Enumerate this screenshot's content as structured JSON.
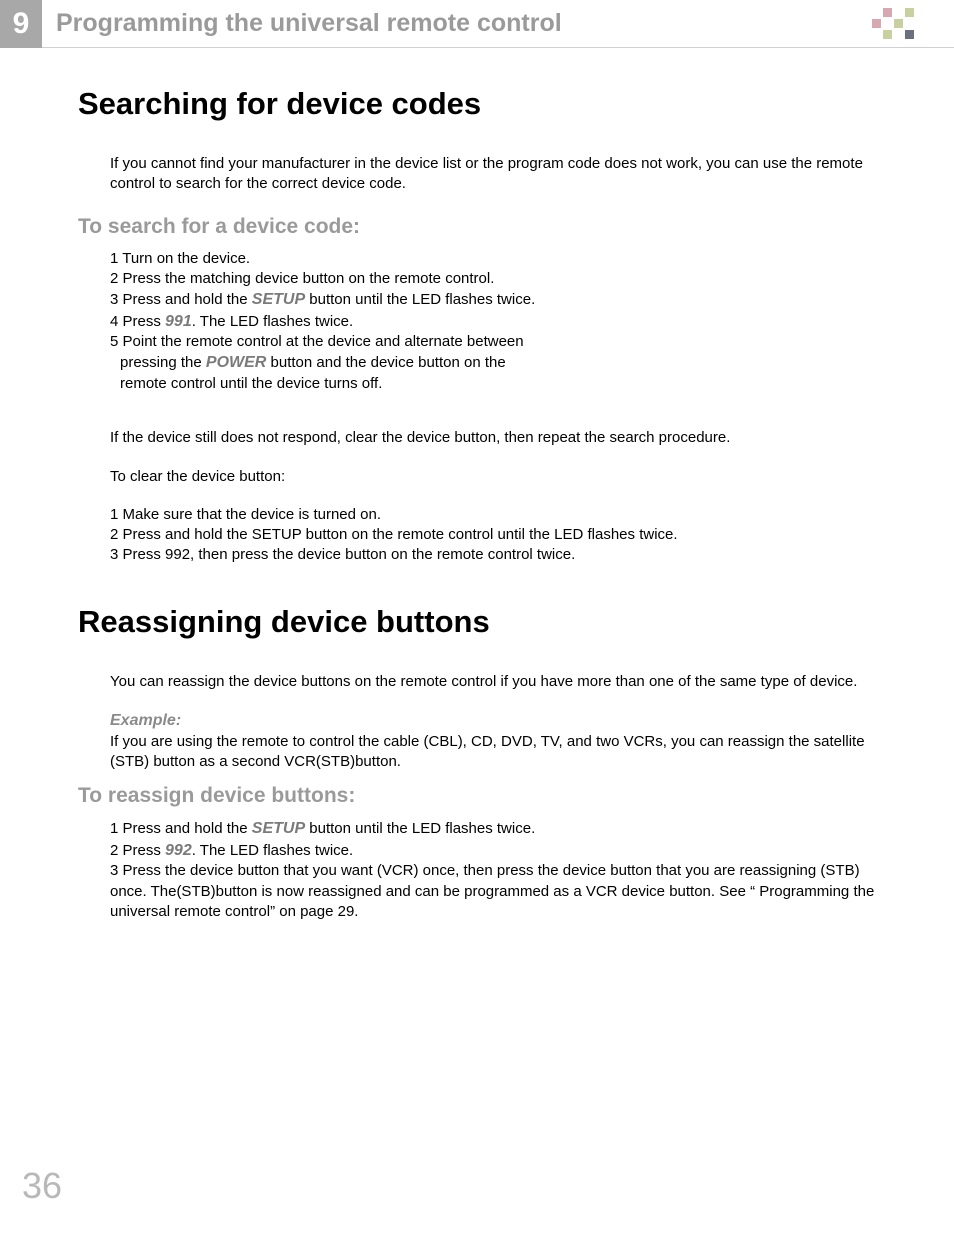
{
  "header": {
    "chapter_number": "9",
    "chapter_title": "Programming the universal remote control"
  },
  "section1": {
    "title": "Searching for device codes",
    "intro": "If you cannot find your manufacturer in the device list or the program code does not work, you can use the remote control to search for the correct device code.",
    "sub_title": "To search for a device code:",
    "steps": {
      "s1": "1 Turn on the device.",
      "s2": "2 Press the matching device button on the remote control.",
      "s3a": "3 Press and hold the ",
      "s3_kw": "SETUP",
      "s3b": " button until the LED flashes twice.",
      "s4a": "4 Press ",
      "s4_kw": "991",
      "s4b": ". The LED flashes twice.",
      "s5a": "5 Point the remote control at the device and alternate between",
      "s5b_a": "pressing the ",
      "s5b_kw": "POWER",
      "s5b_b": " button and the device button on the",
      "s5c": "remote control until the device turns off."
    },
    "para2": "If the device still does not respond, clear the device button, then repeat the search procedure.",
    "para3": " To clear the device button:",
    "clear_steps": {
      "c1": "1 Make sure that the device is turned on.",
      "c2": "2 Press and hold the SETUP button on the remote control until the LED flashes twice.",
      "c3": "3 Press 992, then press the device button on the remote control twice."
    }
  },
  "section2": {
    "title": "Reassigning device buttons",
    "intro": "You can reassign the device buttons on the remote control if you have more than one of the same type of device.",
    "example_label": "Example:",
    "example_text": "If you are using the remote to control the cable (CBL), CD, DVD, TV, and two VCRs, you can reassign the satellite (STB) button as a second VCR(STB)button.",
    "sub_title": "To reassign device buttons:",
    "steps": {
      "r1a": "1 Press and hold the ",
      "r1_kw": "SETUP",
      "r1b": " button until the LED flashes twice.",
      "r2a": "2 Press ",
      "r2_kw": "992",
      "r2b": ". The LED flashes twice.",
      "r3": "3 Press the device button that you want (VCR) once, then press the device button that you are reassigning (STB) once. The(STB)button is now reassigned and can be programmed as a VCR device button. See “ Programming the universal remote control” on page 29."
    }
  },
  "page_number": "36"
}
